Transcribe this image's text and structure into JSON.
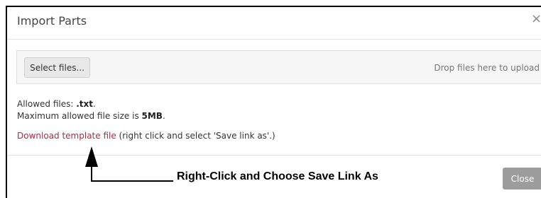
{
  "dialog": {
    "title": "Import Parts",
    "close_glyph": "×",
    "close_icon": "close-icon",
    "upload": {
      "select_label": "Select files...",
      "drop_hint": "Drop files here to upload"
    },
    "allowed_prefix": "Allowed files: ",
    "allowed_ext": ".txt",
    "allowed_suffix": ".",
    "max_prefix": "Maximum allowed file size is ",
    "max_size": "5MB",
    "max_suffix": ".",
    "download_link": "Download template file",
    "download_note": " (right click and select 'Save link as'.)",
    "footer_close": "Close"
  },
  "annotation": {
    "text": "Right-Click and Choose Save Link As",
    "arrow_icon": "up-arrow-icon"
  },
  "colors": {
    "link": "#b5283b",
    "close_button": "#9c9c9c",
    "upload_bg": "#f6f6f6"
  }
}
